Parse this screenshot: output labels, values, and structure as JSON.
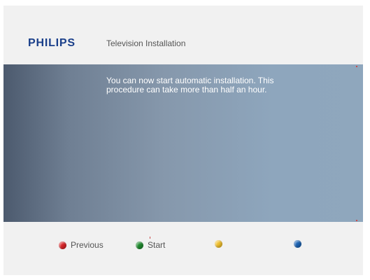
{
  "header": {
    "brand": "PHILIPS",
    "title": "Television Installation"
  },
  "panel": {
    "message_line1": "You can now start automatic installation. This",
    "message_line2": "procedure can take more than half an hour."
  },
  "footer": {
    "keys": [
      {
        "color_name": "red",
        "color": "#d8262a",
        "label": "Previous"
      },
      {
        "color_name": "green",
        "color": "#1f8a2e",
        "label": "Start"
      },
      {
        "color_name": "yellow",
        "color": "#f2c12e",
        "label": ""
      },
      {
        "color_name": "blue",
        "color": "#1d64b4",
        "label": ""
      }
    ]
  },
  "colors": {
    "brand": "#1a3f8a",
    "panel_left": "#4c5a6e",
    "panel_right": "#8fa7bd",
    "background": "#f1f1f1"
  }
}
